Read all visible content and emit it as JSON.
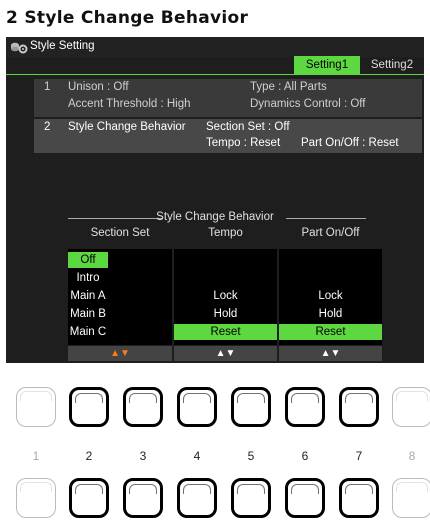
{
  "heading": "2 Style Change Behavior",
  "window": {
    "title": "Style Setting",
    "icon": "gear-disk-icon"
  },
  "tabs": [
    {
      "label": "Setting1",
      "active": true
    },
    {
      "label": "Setting2",
      "active": false
    }
  ],
  "rows": {
    "row1": {
      "num": "1",
      "unison": "Unison : Off",
      "type": "Type : All Parts",
      "accent": "Accent Threshold : High",
      "dynamics": "Dynamics Control : Off"
    },
    "row2": {
      "num": "2",
      "label": "Style Change Behavior",
      "section_set": "Section Set : Off",
      "tempo": "Tempo : Reset",
      "part": "Part On/Off : Reset"
    }
  },
  "behavior": {
    "title": "Style Change Behavior",
    "columns": {
      "section_set": {
        "header": "Section Set",
        "options": [
          "Off",
          "Intro",
          "Main A",
          "Main B",
          "Main C"
        ],
        "selected": "Off"
      },
      "tempo": {
        "header": "Tempo",
        "options": [
          "Lock",
          "Hold",
          "Reset"
        ],
        "selected": "Reset"
      },
      "part": {
        "header": "Part On/Off",
        "options": [
          "Lock",
          "Hold",
          "Reset"
        ],
        "selected": "Reset"
      }
    },
    "arrows": "▲▼"
  },
  "buttons": {
    "numbers": [
      "1",
      "2",
      "3",
      "4",
      "5",
      "6",
      "7",
      "8"
    ]
  },
  "colors": {
    "accent": "#5dd840",
    "screen_bg": "#1e1e1e",
    "arrow_orange": "#ff7a1a"
  }
}
